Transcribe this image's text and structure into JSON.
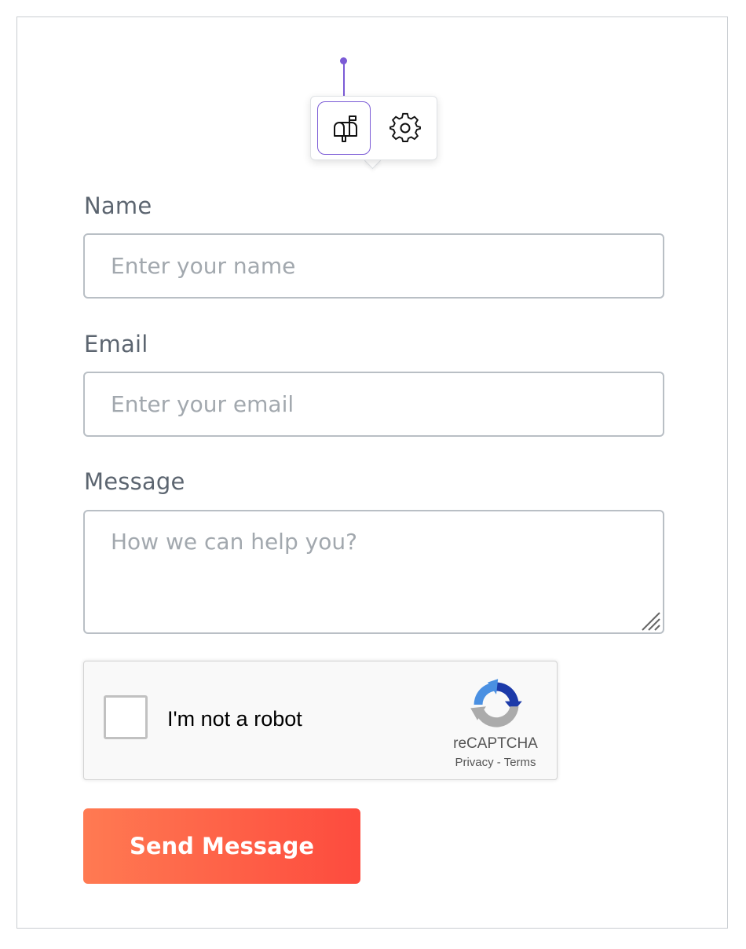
{
  "toolbar": {
    "accent_color": "#7b5bd6",
    "buttons": [
      {
        "icon": "mailbox-icon",
        "active": true
      },
      {
        "icon": "gear-icon",
        "active": false
      }
    ]
  },
  "form": {
    "name": {
      "label": "Name",
      "placeholder": "Enter your name",
      "value": ""
    },
    "email": {
      "label": "Email",
      "placeholder": "Enter your email",
      "value": ""
    },
    "message": {
      "label": "Message",
      "placeholder": "How we can help you?",
      "value": ""
    },
    "captcha": {
      "checkbox_label": "I'm not a robot",
      "brand": "reCAPTCHA",
      "privacy": "Privacy",
      "separator": " - ",
      "terms": "Terms",
      "checked": false
    },
    "submit_label": "Send Message",
    "submit_gradient": [
      "#ff7a52",
      "#fd4b3e"
    ]
  }
}
